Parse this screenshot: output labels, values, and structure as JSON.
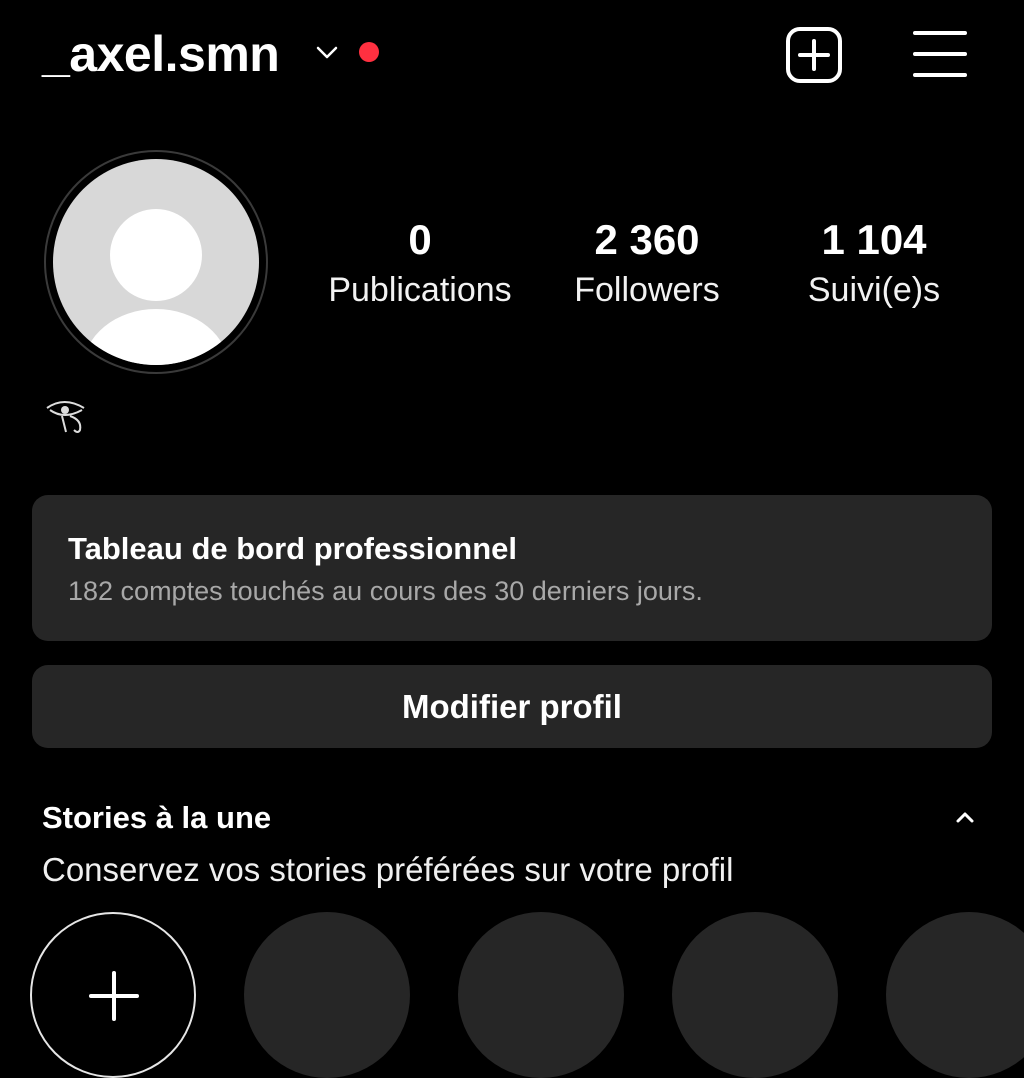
{
  "header": {
    "username": "_axel.smn",
    "icons": [
      "chevron-down-icon",
      "notification-dot",
      "new-post-icon",
      "menu-icon"
    ],
    "notification_color": "#ff3040"
  },
  "profile": {
    "stats": [
      {
        "value": "0",
        "label": "Publications"
      },
      {
        "value": "2 360",
        "label": "Followers"
      },
      {
        "value": "1 104",
        "label": "Suivi(e)s"
      }
    ],
    "bio_icon": "eye-of-horus-icon"
  },
  "dashboard": {
    "title": "Tableau de bord professionnel",
    "subtitle": "182 comptes touchés au cours des 30 derniers jours."
  },
  "edit_profile_label": "Modifier profil",
  "highlights": {
    "title": "Stories à la une",
    "subtitle": "Conservez vos stories préférées sur votre profil",
    "new_icon": "plus-icon"
  },
  "colors": {
    "background": "#000000",
    "card": "#262626",
    "muted_text": "#a8a8a8"
  }
}
